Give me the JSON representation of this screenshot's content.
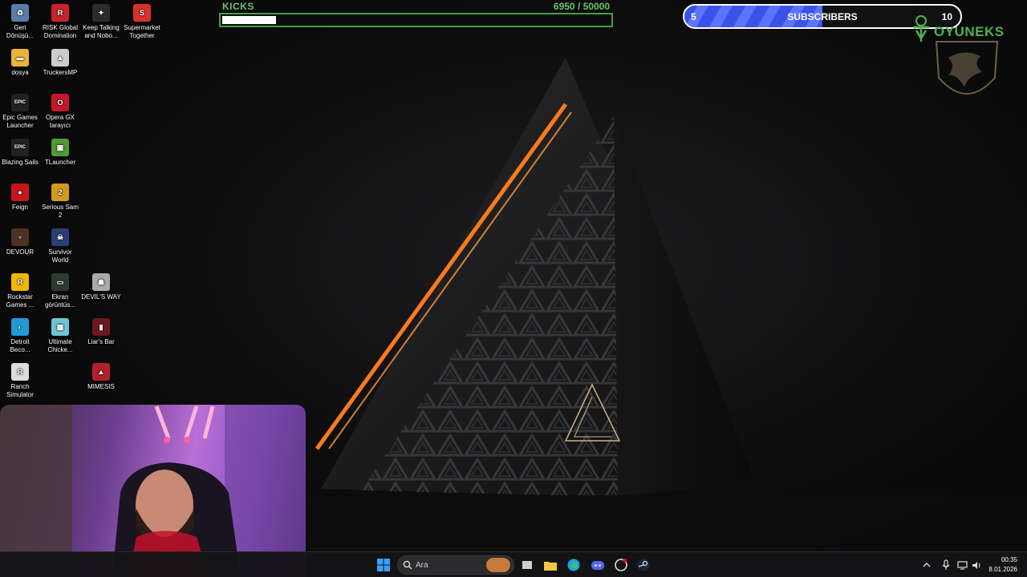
{
  "desktop": {
    "icons": [
      {
        "label": "Geri Dönüşü...",
        "icon": "recycle-bin-icon",
        "color": "#5a7ea8"
      },
      {
        "label": "RISK Global Domination",
        "icon": "risk-icon",
        "color": "#c9242b"
      },
      {
        "label": "Keep Talking and Nobo...",
        "icon": "keep-talking-icon",
        "color": "#2b2b2b"
      },
      {
        "label": "Supermarket Together",
        "icon": "supermarket-icon",
        "color": "#d8312c"
      },
      {
        "label": "dosya",
        "icon": "folder-icon",
        "color": "#e8b43a"
      },
      {
        "label": "TruckersMP",
        "icon": "truckersmp-icon",
        "color": "#cccccc"
      },
      {
        "label": "Epic Games Launcher",
        "icon": "epic-games-icon",
        "color": "#222222"
      },
      {
        "label": "Opera GX tarayıcı",
        "icon": "opera-gx-icon",
        "color": "#c2172c"
      },
      {
        "label": "Blazing Sails",
        "icon": "epic-games-icon",
        "color": "#222222"
      },
      {
        "label": "TLauncher",
        "icon": "tlauncher-icon",
        "color": "#4f9a34"
      },
      {
        "label": "Feign",
        "icon": "feign-icon",
        "color": "#c4161c"
      },
      {
        "label": "Serious Sam 2",
        "icon": "serious-sam-icon",
        "color": "#d39a1f"
      },
      {
        "label": "DEVOUR",
        "icon": "devour-icon",
        "color": "#4a3324"
      },
      {
        "label": "Survivor World",
        "icon": "survivor-world-icon",
        "color": "#2d3d78"
      },
      {
        "label": "Rockstar Games ...",
        "icon": "rockstar-icon",
        "color": "#f2b705"
      },
      {
        "label": "Ekran görüntüs...",
        "icon": "screenshot-icon",
        "color": "#2d3b33"
      },
      {
        "label": "DEVIL'S WAY",
        "icon": "devils-way-icon",
        "color": "#aaaaaa"
      },
      {
        "label": "Detroit Beco...",
        "icon": "detroit-icon",
        "color": "#1f9bd6"
      },
      {
        "label": "Ultimate Chicke...",
        "icon": "ultimate-chicken-icon",
        "color": "#6cc4d4"
      },
      {
        "label": "Liar's Bar",
        "icon": "liars-bar-icon",
        "color": "#6d1820"
      },
      {
        "label": "Ranch Simulator",
        "icon": "ranch-simulator-icon",
        "color": "#dddddd"
      },
      {
        "label": "MIMESIS",
        "icon": "mimesis-icon",
        "color": "#b0212b"
      }
    ],
    "icon_glyphs": [
      "♻",
      "R",
      "✦",
      "S",
      "▬",
      "▲",
      "EPIC",
      "O",
      "EPIC",
      "▦",
      "●",
      "2",
      "♆",
      "☠",
      "R",
      "▭",
      "☗",
      "◐",
      "▩",
      "▮",
      "R",
      "▲"
    ]
  },
  "kicks": {
    "label": "KICKS",
    "current": "6950",
    "target": "/ 50000",
    "progress": 0.139
  },
  "subscribers": {
    "current": "5",
    "title": "SUBSCRIBERS",
    "target": "10",
    "progress": 0.5,
    "fill_color": "#3a52e8"
  },
  "brand": {
    "name": "OYUNEKS",
    "color": "#4fb14f"
  },
  "taskbar": {
    "search_placeholder": "Ara",
    "time": "00:35",
    "date": "8.01.2026",
    "apps": [
      "start-icon",
      "search-icon",
      "game-launcher-icon",
      "task-view-icon",
      "file-explorer-icon",
      "edge-icon",
      "discord-icon",
      "obs-icon",
      "steam-icon"
    ],
    "tray": [
      "chevron-up-icon",
      "microphone-icon",
      "display-icon",
      "speaker-icon"
    ]
  }
}
